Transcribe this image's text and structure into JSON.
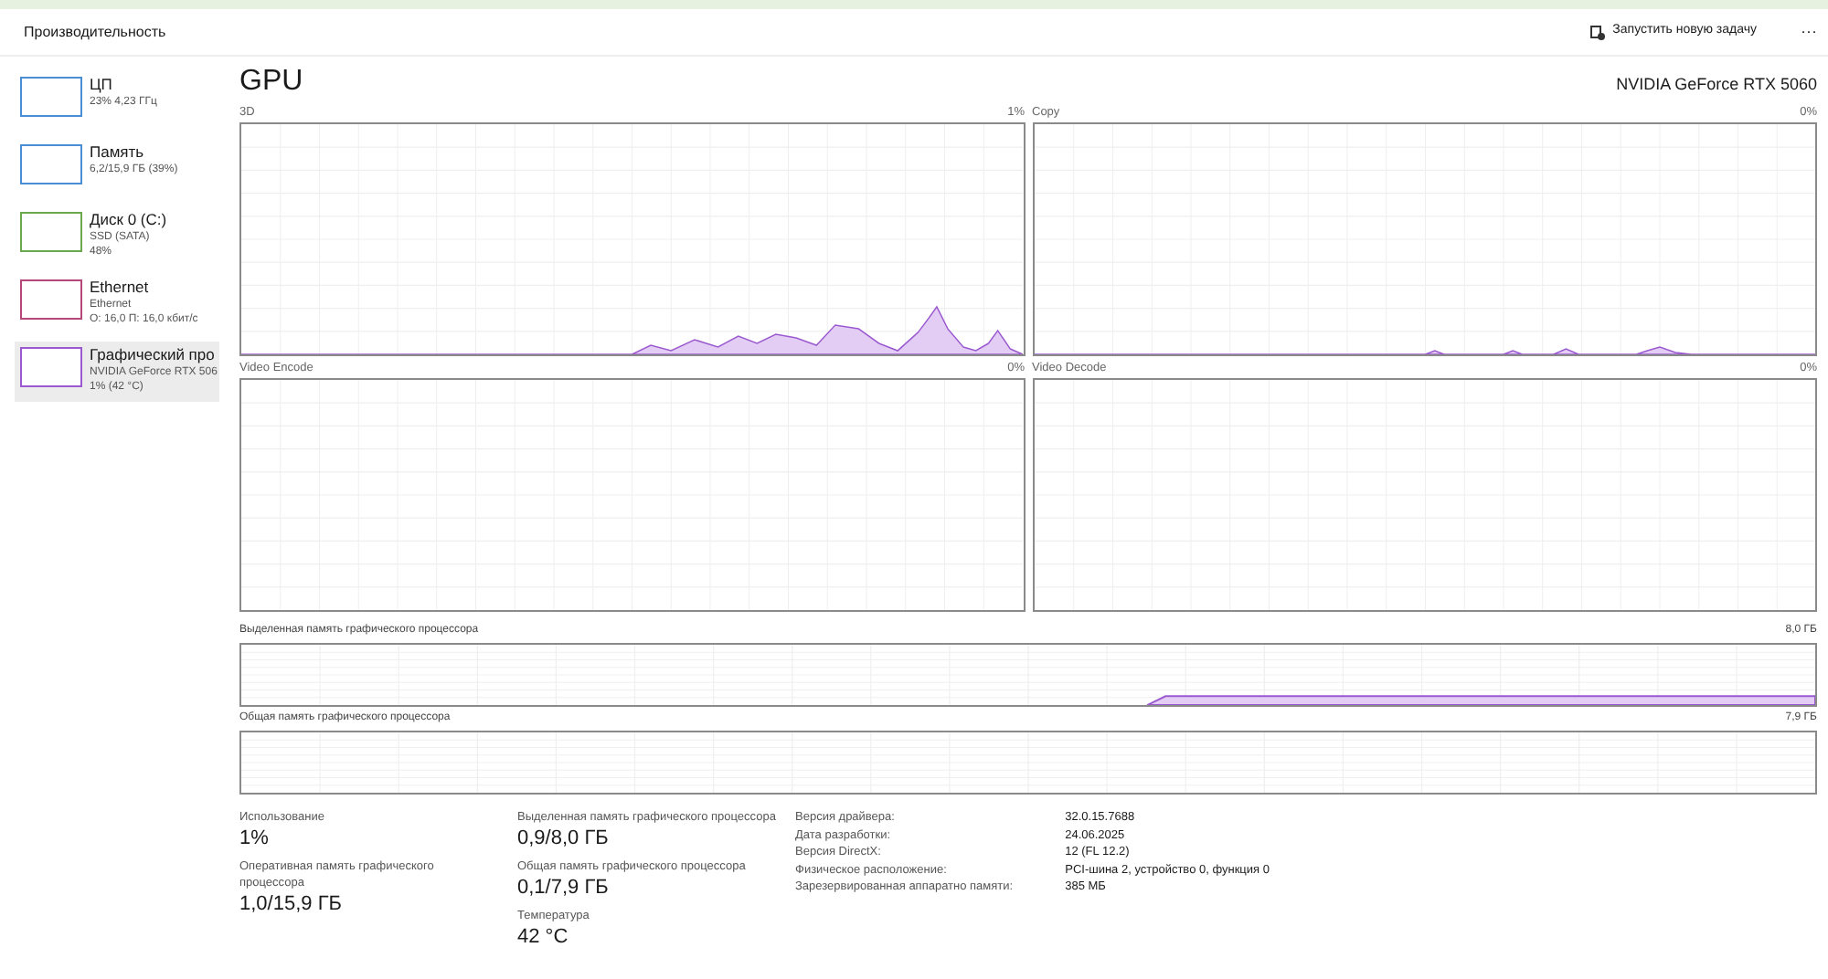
{
  "header": {
    "title": "Производительность",
    "run_task": "Запустить новую задачу",
    "more": "···"
  },
  "sidebar": {
    "items": [
      {
        "title": "ЦП",
        "lines": [
          "23% 4,23 ГГц"
        ],
        "color": "#4a8fd4",
        "selected": false
      },
      {
        "title": "Память",
        "lines": [
          "6,2/15,9 ГБ (39%)"
        ],
        "color": "#4a8fd4",
        "selected": false
      },
      {
        "title": "Диск 0 (C:)",
        "lines": [
          "SSD (SATA)",
          "48%"
        ],
        "color": "#6aa84f",
        "selected": false
      },
      {
        "title": "Ethernet",
        "lines": [
          "Ethernet",
          "О: 16,0 П: 16,0 кбит/с"
        ],
        "color": "#b5477a",
        "selected": false
      },
      {
        "title": "Графический про",
        "lines": [
          "NVIDIA GeForce RTX 506",
          "1% (42 °C)"
        ],
        "color": "#9b59d0",
        "selected": true
      }
    ]
  },
  "main": {
    "title": "GPU",
    "device": "NVIDIA GeForce RTX 5060",
    "engines": [
      {
        "label": "3D",
        "value": "1%"
      },
      {
        "label": "Copy",
        "value": "0%"
      },
      {
        "label": "Video Encode",
        "value": "0%"
      },
      {
        "label": "Video Decode",
        "value": "0%"
      }
    ],
    "memory_graphs": [
      {
        "label": "Выделенная память графического процессора",
        "value": "8,0 ГБ"
      },
      {
        "label": "Общая память графического процессора",
        "value": "7,9 ГБ"
      }
    ],
    "stats": [
      [
        {
          "label": "Использование",
          "value": "1%"
        },
        {
          "label": "Оперативная память графического процессора",
          "value": "1,0/15,9 ГБ"
        }
      ],
      [
        {
          "label": "Выделенная память графического процессора",
          "value": "0,9/8,0 ГБ"
        },
        {
          "label": "Общая память графического процессора",
          "value": "0,1/7,9 ГБ"
        },
        {
          "label": "Температура",
          "value": "42 °C"
        }
      ]
    ],
    "details": [
      {
        "label": "Версия драйвера:",
        "value": "32.0.15.7688"
      },
      {
        "label": "Дата разработки:",
        "value": "24.06.2025"
      },
      {
        "label": "Версия DirectX:",
        "value": "12 (FL 12.2)"
      },
      {
        "label": "Физическое расположение:",
        "value": "PCI-шина 2, устройство 0, функция 0"
      },
      {
        "label": "Зарезервированная аппаратно памяти:",
        "value": "385 МБ"
      }
    ]
  }
}
